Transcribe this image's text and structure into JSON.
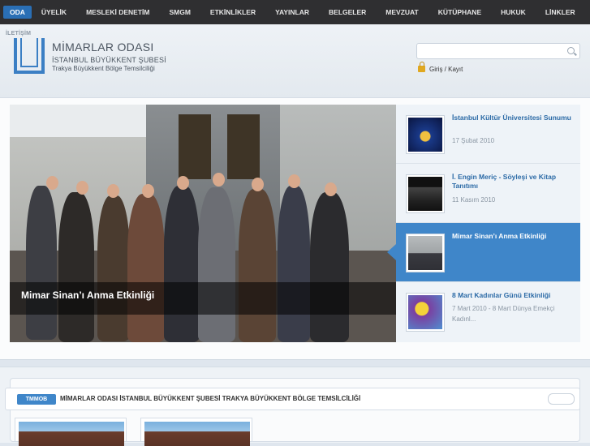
{
  "nav": {
    "items": [
      "ODA",
      "ÜYELİK",
      "MESLEKİ DENETİM",
      "SMGM",
      "ETKİNLİKLER",
      "YAYINLAR",
      "BELGELER",
      "MEVZUAT",
      "KÜTÜPHANE",
      "HUKUK",
      "LİNKLER"
    ],
    "active": "ODA",
    "sub_item": "İLETİŞİM"
  },
  "logo": {
    "line1": "MİMARLAR ODASI",
    "line2": "İSTANBUL BÜYÜKKENT ŞUBESİ",
    "line3": "Trakya Büyükkent Bölge Temsilciliği"
  },
  "search": {
    "placeholder": "",
    "icon": "search-icon"
  },
  "login": {
    "label": "Giriş / Kayıt",
    "icon": "lock-icon"
  },
  "slider": {
    "caption": "Mimar Sinan’ı Anma Etkinliği",
    "items": [
      {
        "title": "İstanbul Kültür Üniversitesi Sunumu",
        "date": "17 Şubat 2010",
        "active": false
      },
      {
        "title": "İ. Engin Meriç - Söyleşi ve Kitap Tanıtımı",
        "date": "11 Kasım 2010",
        "active": false
      },
      {
        "title": "Mimar Sinan’ı Anma Etkinliği",
        "date": "",
        "active": true
      },
      {
        "title": "8 Mart Kadınlar Günü Etkinliği",
        "date": "7 Mart 2010 - 8 Mart Dünya Emekçi Kadınl...",
        "active": false
      }
    ]
  },
  "ticker": {
    "badge": "TMMOB",
    "text": "MİMARLAR ODASI İSTANBUL BÜYÜKKENT ŞUBESİ TRAKYA BÜYÜKKENT BÖLGE TEMSİLCİLİĞİ"
  },
  "colors": {
    "accent": "#3f86c9",
    "nav_bg": "#2f2f31"
  }
}
